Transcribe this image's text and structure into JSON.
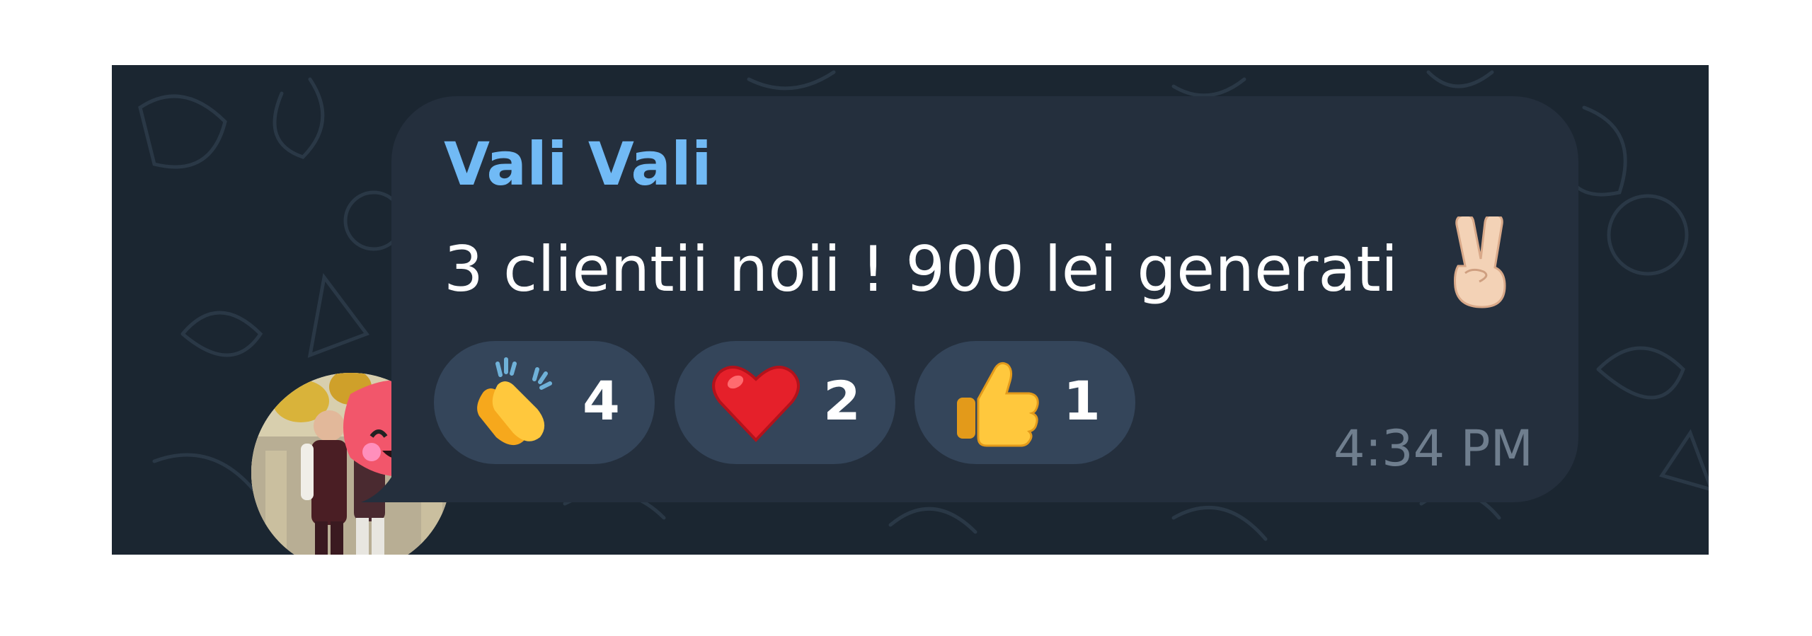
{
  "message": {
    "sender": "Vali Vali",
    "text": "3 clientii noii ! 900 lei generati",
    "text_emoji": "victory-hand-emoji",
    "time": "4:34 PM"
  },
  "reactions": [
    {
      "emoji": "clapping-hands-emoji",
      "count": "4"
    },
    {
      "emoji": "red-heart-emoji",
      "count": "2"
    },
    {
      "emoji": "thumbs-up-emoji",
      "count": "1"
    }
  ],
  "colors": {
    "chat_background": "#1b2631",
    "bubble": "#242f3d",
    "sender_name": "#71baf5",
    "reaction_pill": "#34455a",
    "timestamp": "#6f7e8e"
  }
}
